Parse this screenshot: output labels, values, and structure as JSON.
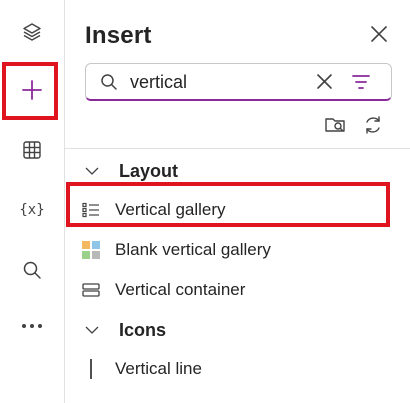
{
  "rail": {
    "items": [
      {
        "icon": "layers-icon"
      },
      {
        "icon": "plus-icon",
        "active": true
      },
      {
        "icon": "table-icon"
      },
      {
        "icon": "variable-icon",
        "text": "{x}"
      },
      {
        "icon": "search-icon"
      },
      {
        "icon": "more-icon"
      }
    ]
  },
  "pane": {
    "title": "Insert",
    "search": {
      "value": "vertical",
      "placeholder": "Search"
    },
    "sections": [
      {
        "label": "Layout",
        "items": [
          {
            "label": "Vertical gallery",
            "icon": "list-icon"
          },
          {
            "label": "Blank vertical gallery",
            "icon": "colorful-grid-icon"
          },
          {
            "label": "Vertical container",
            "icon": "container-icon"
          }
        ]
      },
      {
        "label": "Icons",
        "items": [
          {
            "label": "Vertical line",
            "icon": "vertical-line-icon"
          }
        ]
      }
    ]
  },
  "colors": {
    "accent": "#8a2a9a",
    "highlight": "#e0141e",
    "text": "#242424"
  }
}
